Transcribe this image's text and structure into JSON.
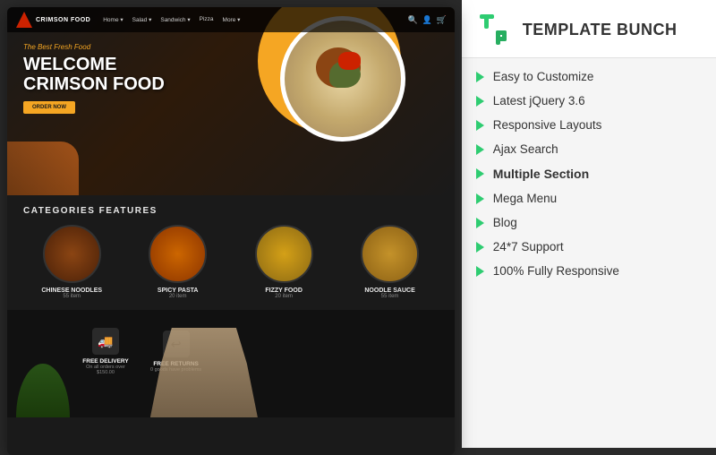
{
  "brand": {
    "logo_text": "TEMPLATE BUNCH",
    "tb_abbreviation": "TB"
  },
  "website_preview": {
    "nav": {
      "logo_text": "CRIMSON FOOD",
      "links": [
        "Home ▾",
        "Salad ▾",
        "Sandwich ▾",
        "Pizza",
        "More ▾"
      ]
    },
    "hero": {
      "subtitle": "The Best Fresh Food",
      "title_line1": "WELCOME",
      "title_line2": "CRIMSON FOOD",
      "cta_label": "ORDER NOW"
    },
    "categories": {
      "section_title": "CATEGORIES FEATURES",
      "items": [
        {
          "name": "CHINESE NOODLES",
          "count": "55 item"
        },
        {
          "name": "SPICY PASTA",
          "count": "20 item"
        },
        {
          "name": "FIZZY FOOD",
          "count": "20 item"
        },
        {
          "name": "NOODLE SAUCE",
          "count": "55 item"
        }
      ]
    },
    "delivery": [
      {
        "icon": "🚚",
        "title": "FREE DELIVERY",
        "desc": "On all orders over $150.00"
      },
      {
        "icon": "↩",
        "title": "FREE RETURNS",
        "desc": "0 goods have problems"
      }
    ]
  },
  "features": [
    {
      "label": "Easy to Customize",
      "highlight": false
    },
    {
      "label": "Latest jQuery 3.6",
      "highlight": false
    },
    {
      "label": "Responsive Layouts",
      "highlight": false
    },
    {
      "label": "Ajax Search",
      "highlight": false
    },
    {
      "label": "Multiple Section",
      "highlight": true
    },
    {
      "label": "Mega Menu",
      "highlight": false
    },
    {
      "label": "Blog",
      "highlight": false
    },
    {
      "label": "24*7 Support",
      "highlight": false
    },
    {
      "label": "100% Fully Responsive",
      "highlight": false
    }
  ]
}
